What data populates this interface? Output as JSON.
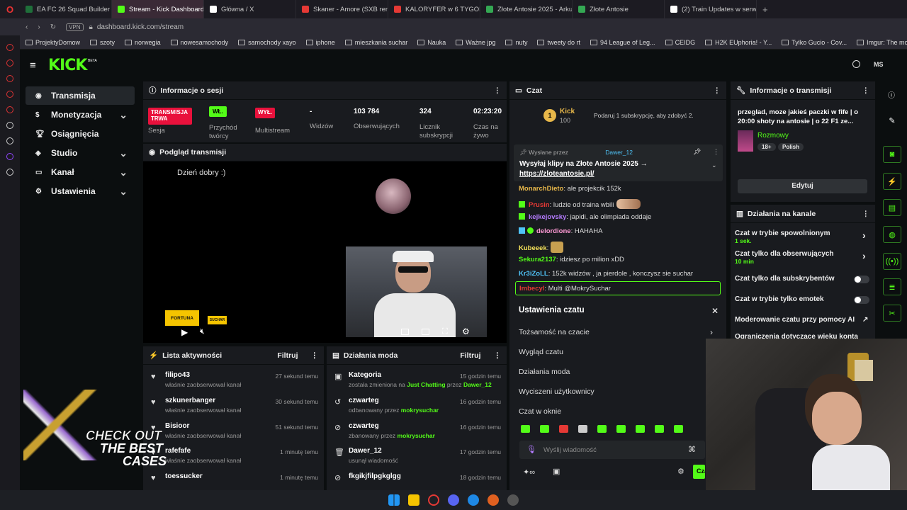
{
  "browser": {
    "tabs": [
      {
        "label": "EA FC 26 Squad Builder |",
        "color": "#1f6f3a"
      },
      {
        "label": "Stream - Kick Dashboard",
        "color": "#53fc18"
      },
      {
        "label": "Główna / X",
        "color": "#ffffff"
      },
      {
        "label": "Skaner - Amore (SXB rem",
        "color": "#e53935"
      },
      {
        "label": "KALORYFER w 6 TYGODN",
        "color": "#e53935"
      },
      {
        "label": "Złote Antosie 2025 - Arku",
        "color": "#34a853"
      },
      {
        "label": "Złote Antosie",
        "color": "#34a853"
      },
      {
        "label": "(2) Train Updates w serw",
        "color": "#ffffff"
      }
    ],
    "vpn": "VPN",
    "url": "dashboard.kick.com/stream",
    "bookmarks": [
      "ProjektyDomow",
      "szoty",
      "norwegia",
      "nowesamochody",
      "samochody xayo",
      "iphone",
      "mieszkania suchar",
      "Nauka",
      "Ważne jpg",
      "nuty",
      "tweety do rt",
      "94 League of Leg...",
      "CEIDG",
      "H2K EUphoria! - Y...",
      "Tylko Gucio - Cov...",
      "Imgur: The most a..."
    ]
  },
  "kick": {
    "logo": "KICK",
    "beta": "BETA",
    "user_initials": "MS",
    "nav": [
      {
        "label": "Transmisja",
        "icon": "broadcast-icon",
        "active": true,
        "chev": false
      },
      {
        "label": "Monetyzacja",
        "icon": "dollar-icon",
        "active": false,
        "chev": true
      },
      {
        "label": "Osiągnięcia",
        "icon": "trophy-icon",
        "active": false,
        "chev": false
      },
      {
        "label": "Studio",
        "icon": "studio-icon",
        "active": false,
        "chev": true
      },
      {
        "label": "Kanał",
        "icon": "channel-icon",
        "active": false,
        "chev": true
      },
      {
        "label": "Ustawienia",
        "icon": "gear-icon",
        "active": false,
        "chev": true
      }
    ],
    "session": {
      "title": "Informacje o sesji",
      "live_badge": "TRANSMISJA TRWA",
      "live_label": "Sesja",
      "creator_badge": "WŁ.",
      "creator_label": "Przychód twórcy",
      "multistream_badge": "WYŁ.",
      "multistream_label": "Multistream",
      "viewers_value": "-",
      "viewers_label": "Widzów",
      "followers_value": "103 784",
      "followers_label": "Obserwujących",
      "subs_value": "324",
      "subs_label": "Licznik subskrypcji",
      "uptime_value": "02:23:20",
      "uptime_label": "Czas na żywo"
    },
    "preview": {
      "title": "Podgląd transmisji",
      "overlay_text": "Dzień dobry :)",
      "sponsor": "FORTUNA",
      "sponsor2": "SUCHAR"
    },
    "activity": {
      "title": "Lista aktywności",
      "filter": "Filtruj",
      "rows": [
        {
          "name": "filipo43",
          "sub": "właśnie zaobserwował kanał",
          "time": "27 sekund temu"
        },
        {
          "name": "szkunerbanger",
          "sub": "właśnie zaobserwował kanał",
          "time": "30 sekund temu"
        },
        {
          "name": "Bisioor",
          "sub": "właśnie zaobserwował kanał",
          "time": "51 sekund temu"
        },
        {
          "name": "rafefafe",
          "sub": "właśnie zaobserwował kanał",
          "time": "1 minutę temu"
        },
        {
          "name": "toessucker",
          "sub": "",
          "time": "1 minutę temu"
        }
      ]
    },
    "mod": {
      "title": "Działania moda",
      "filter": "Filtruj",
      "rows": [
        {
          "name": "Kategoria",
          "pre": "została zmieniona na ",
          "hl": "Just Chatting",
          "mid": " przez ",
          "hl2": "Dawer_12",
          "time": "15 godzin temu",
          "icon": "category-icon"
        },
        {
          "name": "czwarteg",
          "pre": "odbanowany przez ",
          "hl": "mokrysuchar",
          "mid": "",
          "hl2": "",
          "time": "16 godzin temu",
          "icon": "unban-icon"
        },
        {
          "name": "czwarteg",
          "pre": "zbanowany przez ",
          "hl": "mokrysuchar",
          "mid": "",
          "hl2": "",
          "time": "16 godzin temu",
          "icon": "ban-icon"
        },
        {
          "name": "Dawer_12",
          "pre": "usunął wiadomość",
          "hl": "",
          "mid": "",
          "hl2": "",
          "time": "17 godzin temu",
          "icon": "trash-icon"
        },
        {
          "name": "fkgikjfilpgkglgg",
          "pre": "",
          "hl": "",
          "mid": "",
          "hl2": "",
          "time": "18 godzin temu",
          "icon": "ban-icon"
        }
      ]
    },
    "chat": {
      "title": "Czat",
      "kick_label": "Kick",
      "kick_points": "100",
      "sub_promo": "Podaruj 1 subskrypcję, aby zdobyć 2.",
      "pinned_by": "Wysłane przez",
      "pinned_user": "Dawer_12",
      "pinned_text": "Wysyłaj klipy na Złote Antosie 2025 →",
      "pinned_link": "https://zloteantosie.pl/",
      "messages": [
        {
          "user": "MonarchDieto",
          "color": "#e8b84a",
          "text": "ale projekcik 152k"
        },
        {
          "user": "Prusin",
          "color": "#e53935",
          "text": "ludzie od traina wbili"
        },
        {
          "user": "kejkejovsky",
          "color": "#b57cff",
          "text": "japidi, ale olimpiada oddaje"
        },
        {
          "user": "delordione",
          "color": "#ff9ad5",
          "text": "HAHAHA"
        },
        {
          "user": "Kubeeek",
          "color": "#f5e25a",
          "text": ""
        },
        {
          "user": "Sekura2137",
          "color": "#53fc18",
          "text": "idziesz po milion xDD"
        },
        {
          "user": "Kr3iZoLL",
          "color": "#4fc3f7",
          "text": "152k widzów , ja pierdole , konczysz sie suchar"
        },
        {
          "user": "Imbecyl",
          "color": "#e53935",
          "text": "Multi @MokrySuchar"
        }
      ],
      "settings_title": "Ustawienia czatu",
      "settings_items": [
        "Tożsamość na czacie",
        "Wygląd czatu",
        "Działania moda",
        "Wyciszeni użytkownicy",
        "Czat w oknie"
      ],
      "input_placeholder": "Wyślij wiadomość",
      "send_label": "Czat"
    },
    "stream_info": {
      "title": "Informacje o transmisji",
      "stream_title": "przeglad, moze jakieś paczki w fife | o 20:00 shoty na antosie | o 22 F1 ze...",
      "category": "Rozmowy",
      "tags": [
        "18+",
        "Polish"
      ],
      "edit": "Edytuj"
    },
    "channel_actions": {
      "title": "Działania na kanale",
      "items": [
        {
          "label": "Czat w trybie spowolnionym",
          "sub": "1 sek.",
          "type": "chev"
        },
        {
          "label": "Czat tylko dla obserwujących",
          "sub": "10 min",
          "type": "chev"
        },
        {
          "label": "Czat tylko dla subskrybentów",
          "sub": "",
          "type": "toggle"
        },
        {
          "label": "Czat w trybie tylko emotek",
          "sub": "",
          "type": "toggle"
        },
        {
          "label": "Moderowanie czatu przy pomocy AI",
          "sub": "",
          "type": "ext"
        },
        {
          "label": "Ograniczenia dotyczące wieku konta",
          "sub": "",
          "type": "none"
        }
      ]
    },
    "ad": {
      "line1": "CHECK OUT",
      "line2": "THE BEST",
      "line3": "CASES"
    }
  },
  "colors": {
    "accent": "#53fc18",
    "live": "#e9113c",
    "panel": "#191b1f"
  }
}
